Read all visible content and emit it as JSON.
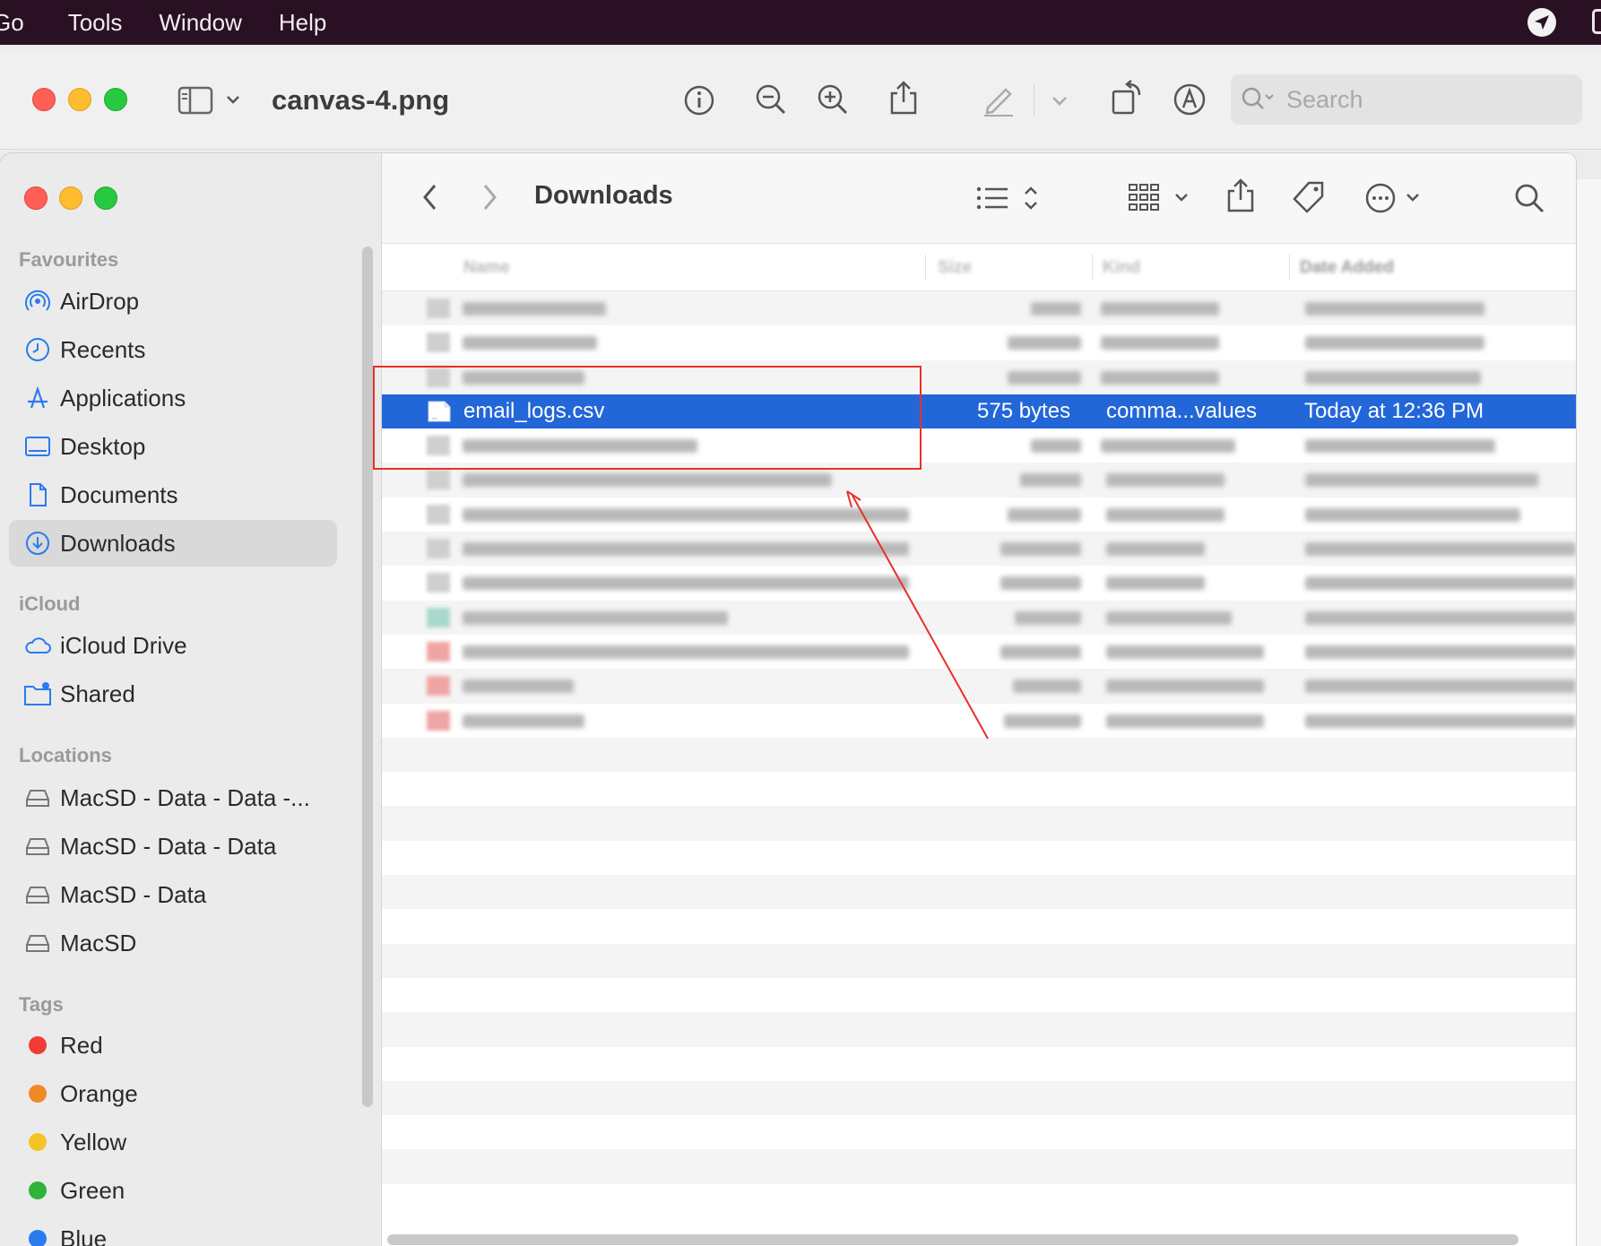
{
  "menubar": {
    "items": [
      "Go",
      "Tools",
      "Window",
      "Help"
    ]
  },
  "preview": {
    "title": "canvas-4.png",
    "search_placeholder": "Search"
  },
  "finder": {
    "title": "Downloads",
    "sidebar": {
      "favourites_label": "Favourites",
      "favourites": [
        "AirDrop",
        "Recents",
        "Applications",
        "Desktop",
        "Documents",
        "Downloads"
      ],
      "icloud_label": "iCloud",
      "icloud": [
        "iCloud Drive",
        "Shared"
      ],
      "locations_label": "Locations",
      "locations": [
        "MacSD - Data - Data -...",
        "MacSD - Data - Data",
        "MacSD - Data",
        "MacSD"
      ],
      "tags_label": "Tags",
      "tags": [
        {
          "name": "Red",
          "color": "#f23b35"
        },
        {
          "name": "Orange",
          "color": "#f08a24"
        },
        {
          "name": "Yellow",
          "color": "#f5c228"
        },
        {
          "name": "Green",
          "color": "#2fb43a"
        },
        {
          "name": "Blue",
          "color": "#2a7bef"
        }
      ]
    },
    "columns": [
      "Name",
      "Size",
      "Kind",
      "Date Added"
    ],
    "selected_file": {
      "name": "email_logs.csv",
      "size": "575 bytes",
      "kind": "comma...values",
      "date_added": "Today at 12:36 PM"
    },
    "accent": "#2366d8"
  }
}
